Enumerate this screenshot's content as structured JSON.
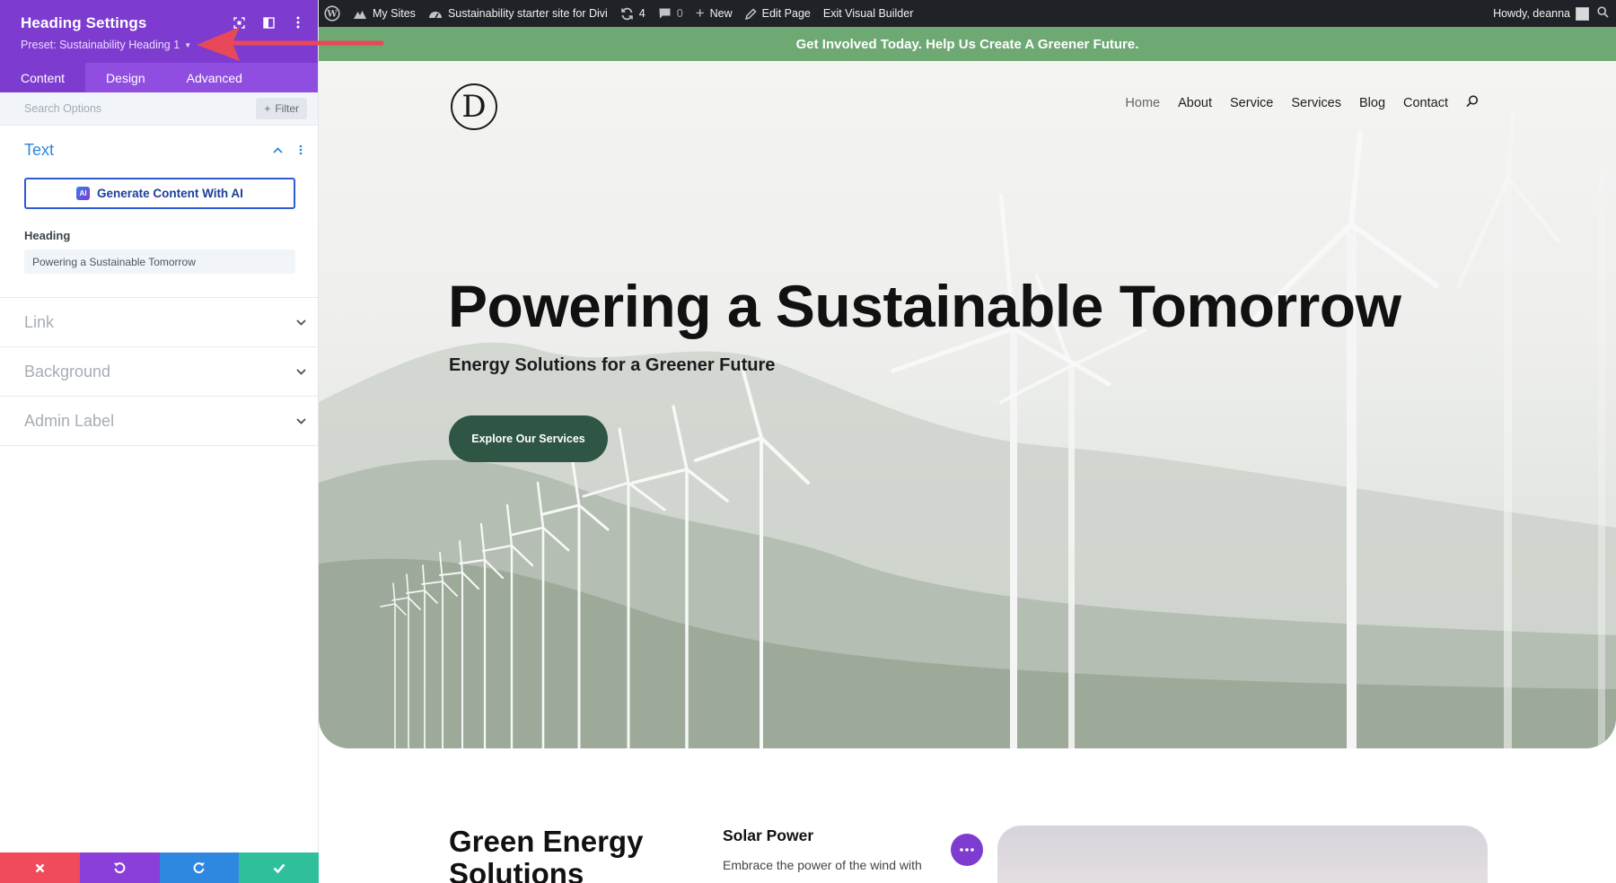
{
  "panel": {
    "title": "Heading Settings",
    "preset": "Preset: Sustainability Heading 1",
    "tabs": [
      {
        "label": "Content"
      },
      {
        "label": "Design"
      },
      {
        "label": "Advanced"
      }
    ],
    "search_placeholder": "Search Options",
    "filter_label": "Filter",
    "sections": {
      "text": {
        "title": "Text",
        "ai_button": "Generate Content With AI",
        "ai_badge": "AI",
        "heading_label": "Heading",
        "heading_value": "Powering a Sustainable Tomorrow"
      },
      "link": {
        "title": "Link"
      },
      "background": {
        "title": "Background"
      },
      "admin_label": {
        "title": "Admin Label"
      }
    },
    "footer_colors": {
      "cancel": "#ef4b5c",
      "undo": "#8b3fd9",
      "redo": "#2e88e0",
      "save": "#2fbf9b"
    }
  },
  "adminbar": {
    "my_sites": "My Sites",
    "site_name": "Sustainability starter site for Divi",
    "updates": "4",
    "comments": "0",
    "new": "New",
    "edit_page": "Edit Page",
    "exit_builder": "Exit Visual Builder",
    "howdy": "Howdy, deanna"
  },
  "promo": "Get Involved Today. Help Us Create A Greener Future.",
  "logo_letter": "D",
  "nav": [
    {
      "label": "Home"
    },
    {
      "label": "About"
    },
    {
      "label": "Service"
    },
    {
      "label": "Services"
    },
    {
      "label": "Blog"
    },
    {
      "label": "Contact"
    }
  ],
  "hero": {
    "title": "Powering a Sustainable Tomorrow",
    "subtitle": "Energy Solutions for a Greener Future",
    "button": "Explore Our Services"
  },
  "lower": {
    "section_title": "Green Energy Solutions",
    "solar_title": "Solar Power",
    "solar_text": "Embrace the power of the wind with"
  },
  "colors": {
    "builder_purple": "#7e3bd0",
    "accent_blue": "#2b87da",
    "promo_green": "#6ea873",
    "button_green": "#2f5644",
    "annotation_red": "#e8495a"
  }
}
